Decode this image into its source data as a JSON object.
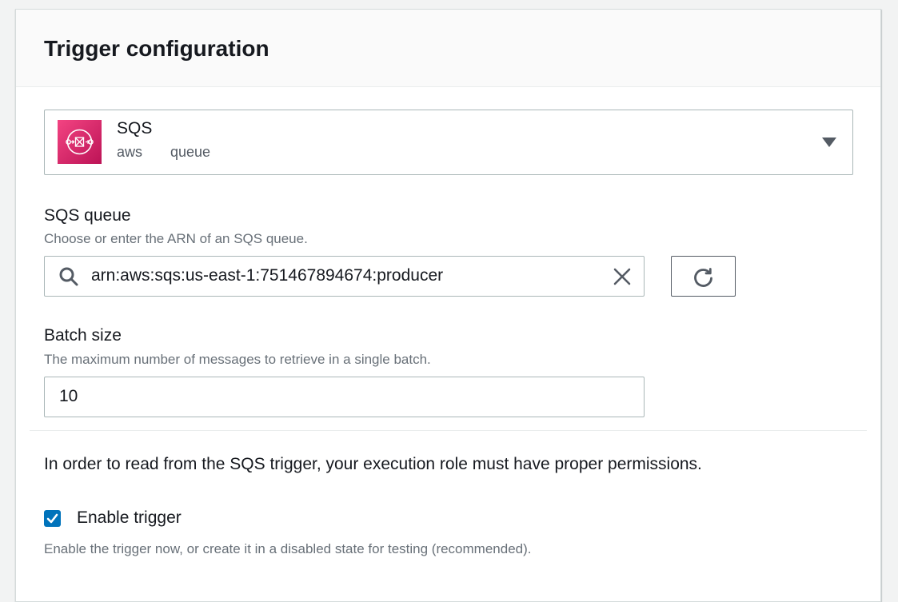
{
  "panel": {
    "title": "Trigger configuration"
  },
  "source": {
    "name": "SQS",
    "tags": [
      "aws",
      "queue"
    ],
    "logo_color": "#e7157b",
    "icon": "sqs-queue-icon"
  },
  "sqs_queue": {
    "label": "SQS queue",
    "description": "Choose or enter the ARN of an SQS queue.",
    "value": "arn:aws:sqs:us-east-1:751467894674:producer",
    "search_icon": "search-icon",
    "clear_icon": "close-icon",
    "refresh_icon": "refresh-icon"
  },
  "batch_size": {
    "label": "Batch size",
    "description": "The maximum number of messages to retrieve in a single batch.",
    "value": "10"
  },
  "permissions_notice": "In order to read from the SQS trigger, your execution role must have proper permissions.",
  "enable_trigger": {
    "label": "Enable trigger",
    "checked": true,
    "description": "Enable the trigger now, or create it in a disabled state for testing (recommended)."
  },
  "colors": {
    "accent": "#0073bb",
    "text": "#16191f",
    "secondary_text": "#687078"
  }
}
